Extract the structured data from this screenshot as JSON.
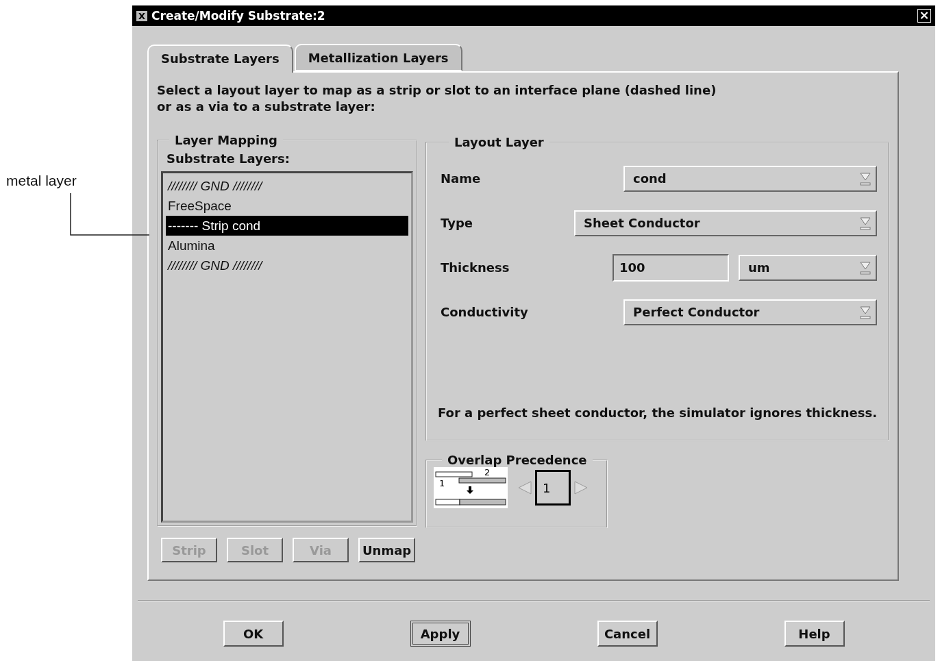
{
  "callout": {
    "label": "metal layer"
  },
  "window": {
    "title": "Create/Modify Substrate:2",
    "menu_glyph": "X",
    "close_glyph": "×"
  },
  "tabs": [
    {
      "label": "Substrate Layers",
      "selected": true
    },
    {
      "label": "Metallization Layers",
      "selected": false
    }
  ],
  "instructions": [
    "Select a layout layer to map as a strip or slot to an interface plane (dashed line)",
    "or as a via to a substrate layer:"
  ],
  "layer_mapping": {
    "title": "Layer Mapping",
    "list_label": "Substrate Layers:",
    "items": [
      {
        "label": "//////// GND ////////",
        "selected": false,
        "kind": "ground"
      },
      {
        "label": "FreeSpace",
        "selected": false,
        "kind": "layer"
      },
      {
        "label": "------- Strip cond",
        "selected": true,
        "kind": "layer"
      },
      {
        "label": "Alumina",
        "selected": false,
        "kind": "layer"
      },
      {
        "label": "//////// GND ////////",
        "selected": false,
        "kind": "ground"
      }
    ],
    "buttons": [
      {
        "label": "Strip",
        "disabled": true
      },
      {
        "label": "Slot",
        "disabled": true
      },
      {
        "label": "Via",
        "disabled": true
      },
      {
        "label": "Unmap",
        "disabled": false
      }
    ]
  },
  "layout_layer": {
    "title": "Layout Layer",
    "fields": [
      {
        "label": "Name",
        "kind": "dropdown",
        "value": "cond"
      },
      {
        "label": "Type",
        "kind": "dropdown",
        "value": "Sheet Conductor"
      },
      {
        "label": "Thickness",
        "kind": "input_unit",
        "value": "100",
        "unit": "um"
      },
      {
        "label": "Conductivity",
        "kind": "dropdown",
        "value": "Perfect Conductor"
      }
    ],
    "note": "For a perfect sheet conductor, the simulator ignores thickness."
  },
  "overlap_precedence": {
    "title": "Overlap Precedence",
    "diagram_labels": [
      "1",
      "2"
    ],
    "value": "1"
  },
  "buttons": [
    {
      "label": "OK",
      "default": false
    },
    {
      "label": "Apply",
      "default": true
    },
    {
      "label": "Cancel",
      "default": false
    },
    {
      "label": "Help",
      "default": false
    }
  ]
}
